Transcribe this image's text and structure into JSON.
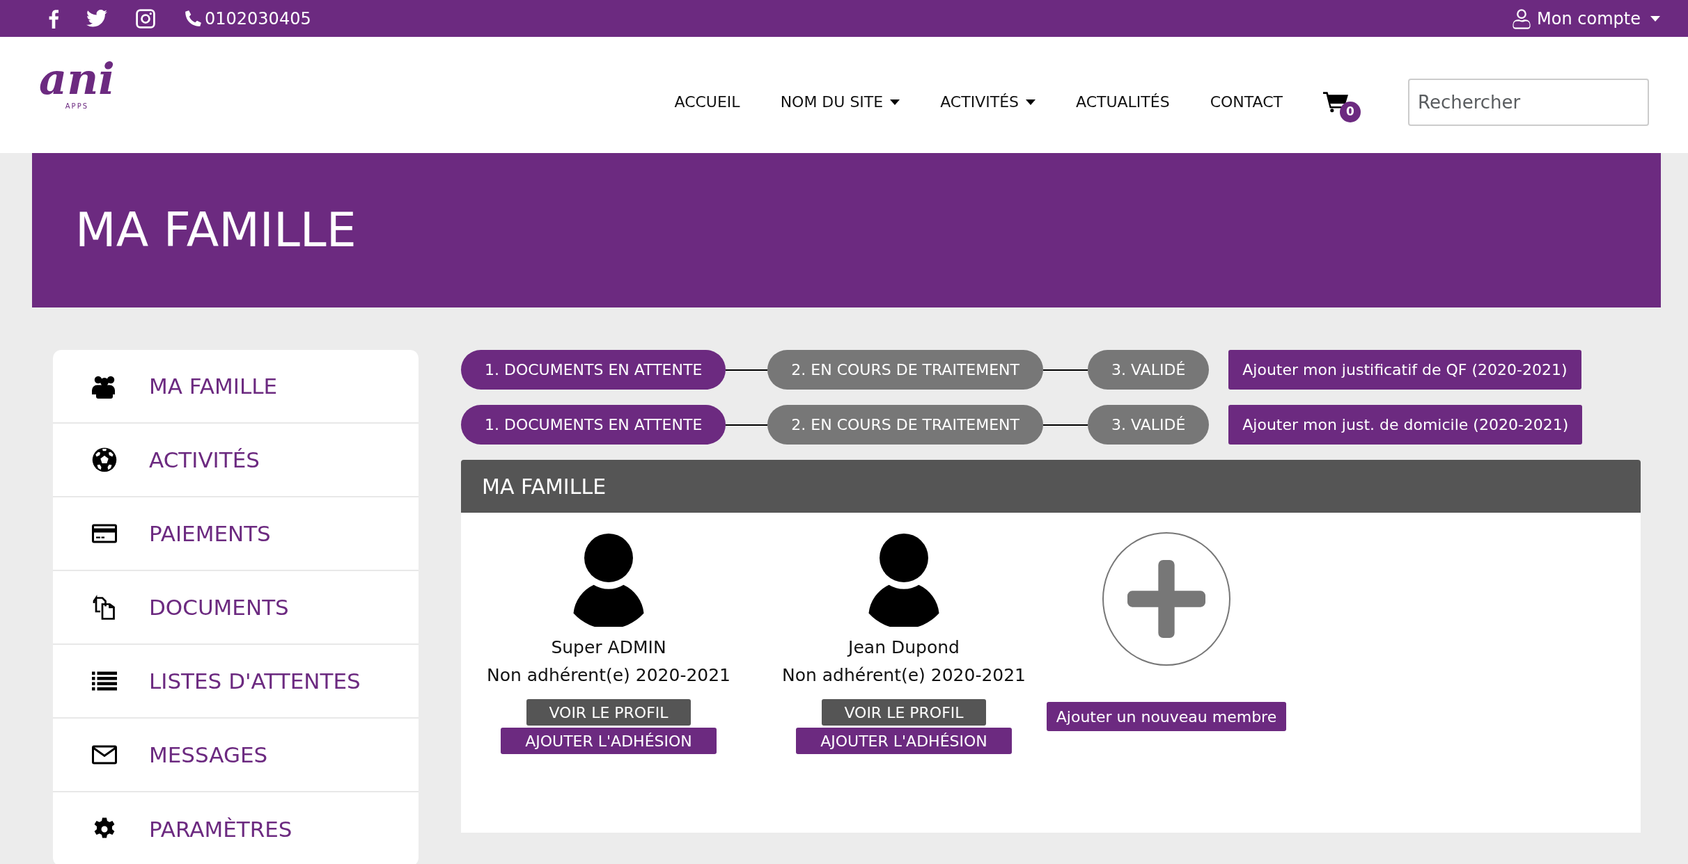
{
  "topbar": {
    "phone": "0102030405",
    "account": "Mon compte"
  },
  "logo": {
    "text": "ani",
    "subtext": "APPS"
  },
  "nav": {
    "items": [
      {
        "label": "ACCUEIL",
        "dropdown": false
      },
      {
        "label": "NOM DU SITE",
        "dropdown": true
      },
      {
        "label": "ACTIVITÉS",
        "dropdown": true
      },
      {
        "label": "ACTUALITÉS",
        "dropdown": false
      },
      {
        "label": "CONTACT",
        "dropdown": false
      }
    ],
    "cart_count": "0",
    "search": {
      "placeholder": "Rechercher"
    }
  },
  "page_title": "MA FAMILLE",
  "sidebar": {
    "items": [
      {
        "label": "MA FAMILLE",
        "kind": "users"
      },
      {
        "label": "ACTIVITÉS",
        "kind": "ball"
      },
      {
        "label": "PAIEMENTS",
        "kind": "card"
      },
      {
        "label": "DOCUMENTS",
        "kind": "docs"
      },
      {
        "label": "LISTES D'ATTENTES",
        "kind": "list"
      },
      {
        "label": "MESSAGES",
        "kind": "mail"
      },
      {
        "label": "PARAMÈTRES",
        "kind": "gear"
      }
    ]
  },
  "workflows": [
    {
      "steps": [
        {
          "label": "1. DOCUMENTS EN ATTENTE",
          "selected": true
        },
        {
          "label": "2. EN COURS DE TRAITEMENT",
          "selected": false
        },
        {
          "label": "3. VALIDÉ",
          "selected": false
        }
      ],
      "action": "Ajouter mon justificatif de QF (2020-2021)"
    },
    {
      "steps": [
        {
          "label": "1. DOCUMENTS EN ATTENTE",
          "selected": true
        },
        {
          "label": "2. EN COURS DE TRAITEMENT",
          "selected": false
        },
        {
          "label": "3. VALIDÉ",
          "selected": false
        }
      ],
      "action": "Ajouter mon just. de domicile (2020-2021)"
    }
  ],
  "family_panel": {
    "title": "MA FAMILLE",
    "members": [
      {
        "name": "Super ADMIN",
        "status": "Non adhérent(e) 2020-2021",
        "profile_button": "VOIR LE PROFIL",
        "membership_button": "AJOUTER L'ADHÉSION"
      },
      {
        "name": "Jean Dupond",
        "status": "Non adhérent(e) 2020-2021",
        "profile_button": "VOIR LE PROFIL",
        "membership_button": "AJOUTER L'ADHÉSION"
      }
    ],
    "add_button": "Ajouter un nouveau membre"
  }
}
